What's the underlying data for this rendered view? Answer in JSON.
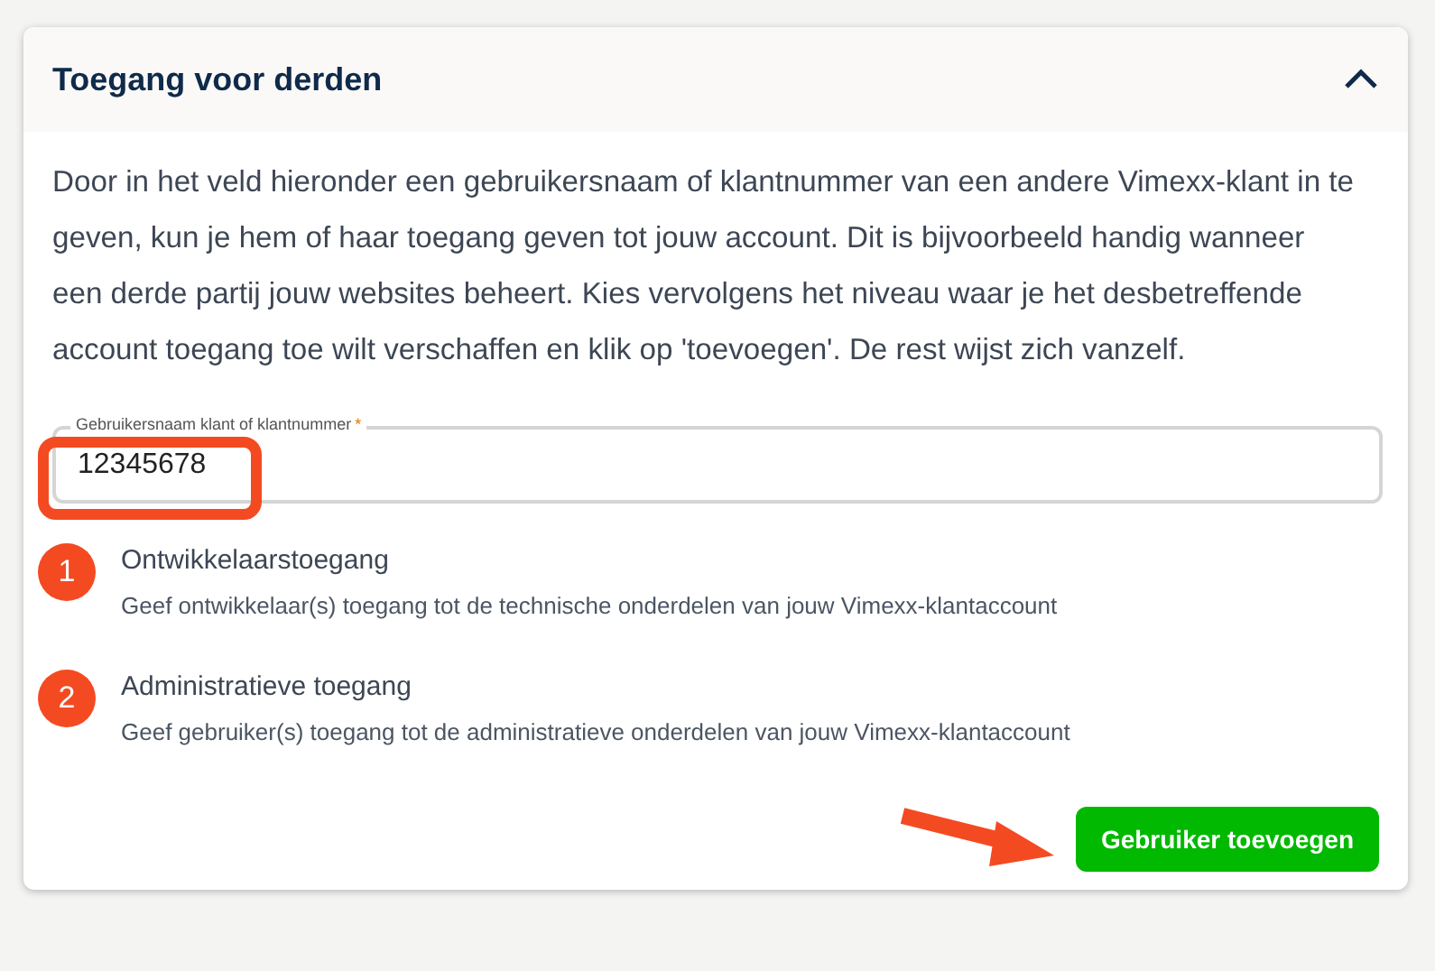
{
  "panel": {
    "title": "Toegang voor derden",
    "expanded": true
  },
  "description": "Door in het veld hieronder een gebruikersnaam of klantnummer van een andere Vimexx-klant in te geven, kun je hem of haar toegang geven tot jouw account. Dit is bijvoorbeeld handig wanneer een derde partij jouw websites beheert. Kies vervolgens het niveau waar je het desbetreffende account toegang toe wilt verschaffen en klik op 'toevoegen'. De rest wijst zich vanzelf.",
  "field": {
    "label": "Gebruikersnaam klant of klantnummer",
    "required_mark": "*",
    "value": "12345678"
  },
  "options": [
    {
      "title": "Ontwikkelaarstoegang",
      "description": "Geef ontwikkelaar(s) toegang tot de technische onderdelen van jouw Vimexx-klantaccount",
      "badge": "1"
    },
    {
      "title": "Administratieve toegang",
      "description": "Geef gebruiker(s) toegang tot de administratieve onderdelen van jouw Vimexx-klantaccount",
      "badge": "2"
    }
  ],
  "button": "Gebruiker toevoegen"
}
